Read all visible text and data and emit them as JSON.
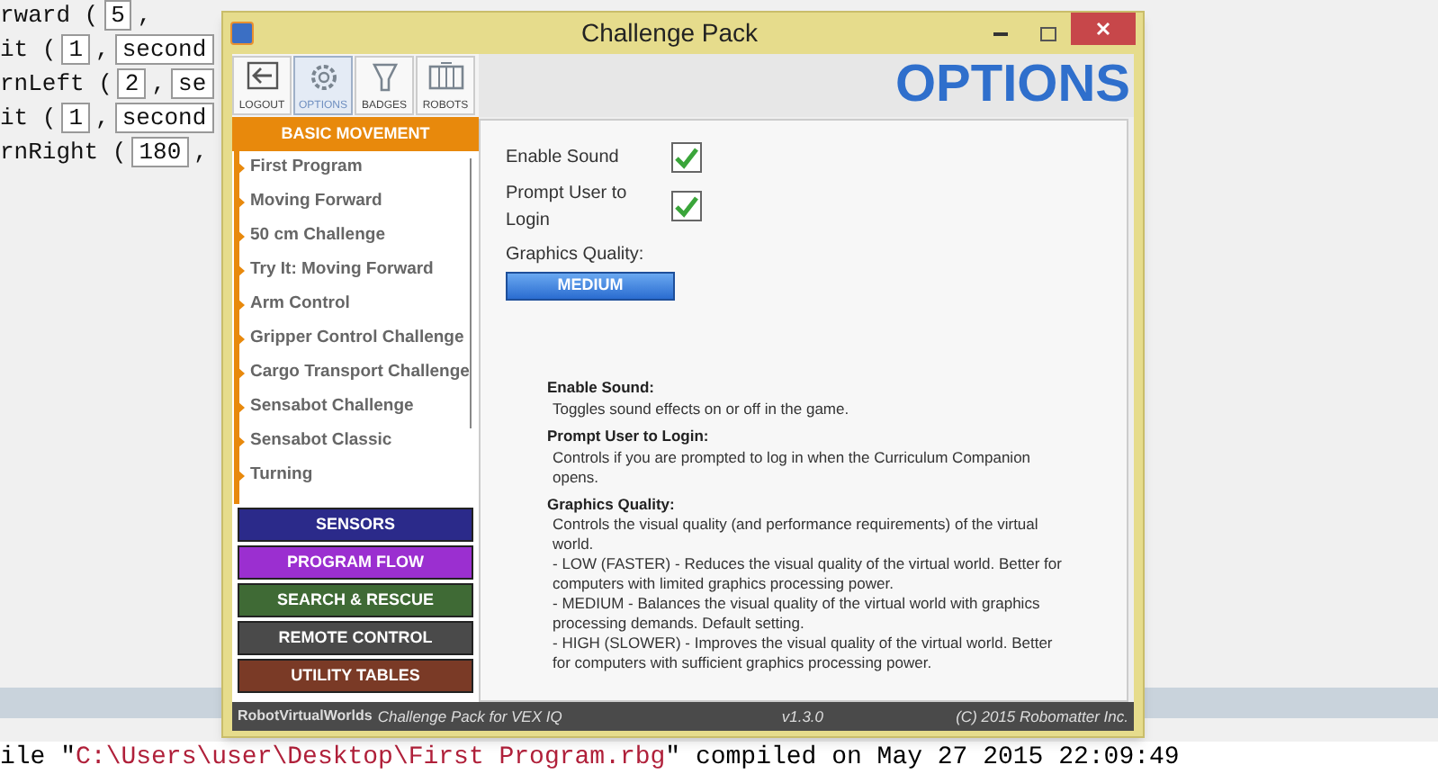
{
  "editor": {
    "lines": [
      {
        "parts": [
          {
            "kind": "text",
            "text": "rward ("
          },
          {
            "kind": "field",
            "text": "5"
          },
          {
            "kind": "text",
            "text": ","
          }
        ]
      },
      {
        "parts": [
          {
            "kind": "text",
            "text": "it ("
          },
          {
            "kind": "field",
            "text": "1"
          },
          {
            "kind": "text",
            "text": ","
          },
          {
            "kind": "field",
            "text": "second"
          }
        ]
      },
      {
        "parts": [
          {
            "kind": "text",
            "text": "rnLeft ("
          },
          {
            "kind": "field",
            "text": "2"
          },
          {
            "kind": "text",
            "text": ","
          },
          {
            "kind": "field",
            "text": "se"
          }
        ]
      },
      {
        "parts": [
          {
            "kind": "text",
            "text": "it ("
          },
          {
            "kind": "field",
            "text": "1"
          },
          {
            "kind": "text",
            "text": ","
          },
          {
            "kind": "field",
            "text": "second"
          }
        ]
      },
      {
        "parts": [
          {
            "kind": "text",
            "text": "rnRight ("
          },
          {
            "kind": "field",
            "text": "180"
          },
          {
            "kind": "text",
            "text": ","
          }
        ]
      }
    ]
  },
  "window": {
    "title": "Challenge Pack",
    "toolbar": [
      {
        "label": "LOGOUT",
        "kind": "logout",
        "selected": false
      },
      {
        "label": "OPTIONS",
        "kind": "options",
        "selected": true
      },
      {
        "label": "BADGES",
        "kind": "badges",
        "selected": false
      },
      {
        "label": "ROBOTS",
        "kind": "robots",
        "selected": false
      }
    ],
    "header": "OPTIONS",
    "categories": [
      {
        "label": "BASIC MOVEMENT",
        "color": "#e8890c",
        "expanded": true,
        "items": [
          "First Program",
          "Moving Forward",
          "50 cm Challenge",
          "Try It: Moving Forward",
          "Arm Control",
          "Gripper Control Challenge",
          "Cargo Transport Challenge",
          "Sensabot Challenge",
          "Sensabot Classic",
          "Turning"
        ]
      },
      {
        "label": "SENSORS",
        "color": "#2b2a8a",
        "expanded": false
      },
      {
        "label": "PROGRAM FLOW",
        "color": "#9b2fd0",
        "expanded": false
      },
      {
        "label": "SEARCH & RESCUE",
        "color": "#3f6a35",
        "expanded": false
      },
      {
        "label": "REMOTE CONTROL",
        "color": "#4a4a4a",
        "expanded": false
      },
      {
        "label": "UTILITY TABLES",
        "color": "#7a3a26",
        "expanded": false
      }
    ],
    "settings": [
      {
        "label": "Enable Sound",
        "checked": true
      },
      {
        "label": "Prompt User to Login",
        "checked": true
      }
    ],
    "graphics_quality": {
      "label": "Graphics Quality:",
      "value": "MEDIUM"
    },
    "help": [
      {
        "title": "Enable Sound:",
        "lines": [
          "Toggles sound effects on or off in the game."
        ]
      },
      {
        "title": "Prompt User to Login:",
        "lines": [
          "Controls if you are prompted to log in when the Curriculum Companion opens."
        ]
      },
      {
        "title": "Graphics Quality:",
        "lines": [
          "Controls the visual quality (and performance requirements) of the virtual world.",
          "- LOW (FASTER) - Reduces the visual quality of the virtual world. Better for computers with limited graphics processing power.",
          "- MEDIUM - Balances the visual quality of the virtual world with graphics processing demands. Default setting.",
          "- HIGH (SLOWER) - Improves the visual quality of the virtual world. Better for computers with sufficient graphics processing power."
        ]
      }
    ],
    "footer": {
      "brand": "RobotVirtualWorlds",
      "product": "Challenge Pack for VEX IQ",
      "version": "v1.3.0",
      "copyright": "(C) 2015 Robomatter Inc."
    }
  },
  "console": {
    "prefix": "ile \"",
    "path": "C:\\Users\\user\\Desktop\\First Program.rbg",
    "suffix": "\" compiled on May 27 2015 22:09:49"
  }
}
